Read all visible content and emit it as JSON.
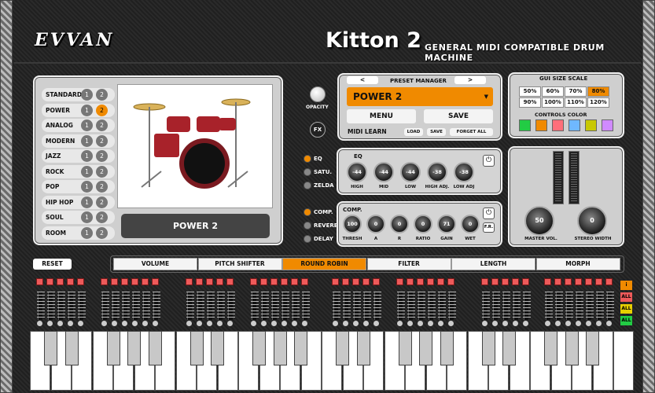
{
  "header": {
    "logo": "EVVAN",
    "title": "Kitton 2",
    "subtitle": "GENERAL MIDI COMPATIBLE DRUM MACHINE"
  },
  "kits": [
    {
      "label": "STANDARD",
      "sel": 0
    },
    {
      "label": "POWER",
      "sel": 2
    },
    {
      "label": "ANALOG",
      "sel": 0
    },
    {
      "label": "MODERN",
      "sel": 0
    },
    {
      "label": "JAZZ",
      "sel": 0
    },
    {
      "label": "ROCK",
      "sel": 0
    },
    {
      "label": "POP",
      "sel": 0
    },
    {
      "label": "HIP HOP",
      "sel": 0
    },
    {
      "label": "SOUL",
      "sel": 0
    },
    {
      "label": "ROOM",
      "sel": 0
    }
  ],
  "kit_num_1": "1",
  "kit_num_2": "2",
  "current_kit": "POWER 2",
  "opacity_label": "OPACITY",
  "fx_label": "FX",
  "preset": {
    "title": "PRESET MANAGER",
    "prev": "<",
    "next": ">",
    "current": "POWER 2",
    "menu": "MENU",
    "save": "SAVE",
    "midi_learn": "MIDI LEARN",
    "load": "LOAD",
    "save_small": "SAVE",
    "forget_all": "FORGET ALL"
  },
  "gui": {
    "title": "GUI SIZE SCALE",
    "sizes": [
      "50%",
      "60%",
      "70%",
      "80%",
      "90%",
      "100%",
      "110%",
      "120%"
    ],
    "selected": "80%",
    "colors_title": "CONTROLS COLOR",
    "colors": [
      "#22cc44",
      "#f08a00",
      "#ff6f7a",
      "#6fb8ff",
      "#c8c800",
      "#d08aff"
    ]
  },
  "fx_modules": {
    "eq": "EQ",
    "satu": "SATU.",
    "zelda": "ZELDA",
    "comp": "COMP.",
    "reverb": "REVERB",
    "delay": "DELAY"
  },
  "eq": {
    "title": "EQ",
    "knobs": [
      {
        "label": "HIGH",
        "value": "-44"
      },
      {
        "label": "MID",
        "value": "-44"
      },
      {
        "label": "LOW",
        "value": "-44"
      },
      {
        "label": "HIGH ADJ.",
        "value": "-38"
      },
      {
        "label": "LOW ADJ",
        "value": "-38"
      }
    ]
  },
  "comp": {
    "title": "COMP.",
    "fr": "F.R.",
    "knobs": [
      {
        "label": "THRESH",
        "value": "100"
      },
      {
        "label": "A",
        "value": "0"
      },
      {
        "label": "R",
        "value": "0"
      },
      {
        "label": "RATIO",
        "value": "0"
      },
      {
        "label": "GAIN",
        "value": "71"
      },
      {
        "label": "WET",
        "value": "0"
      }
    ]
  },
  "master": {
    "vol_label": "MASTER VOL.",
    "vol_value": "50",
    "width_label": "STEREO WIDTH",
    "width_value": "0"
  },
  "reset": "RESET",
  "tabs": [
    "VOLUME",
    "PITCH SHIFTER",
    "ROUND ROBIN",
    "FILTER",
    "LENGTH",
    "MORPH"
  ],
  "active_tab": "ROUND ROBIN",
  "side_buttons": [
    "i",
    "ALL",
    "ALL",
    "ALL"
  ],
  "side_colors": [
    "#f08a00",
    "#ee5a5a",
    "#e8d000",
    "#22cc44"
  ]
}
